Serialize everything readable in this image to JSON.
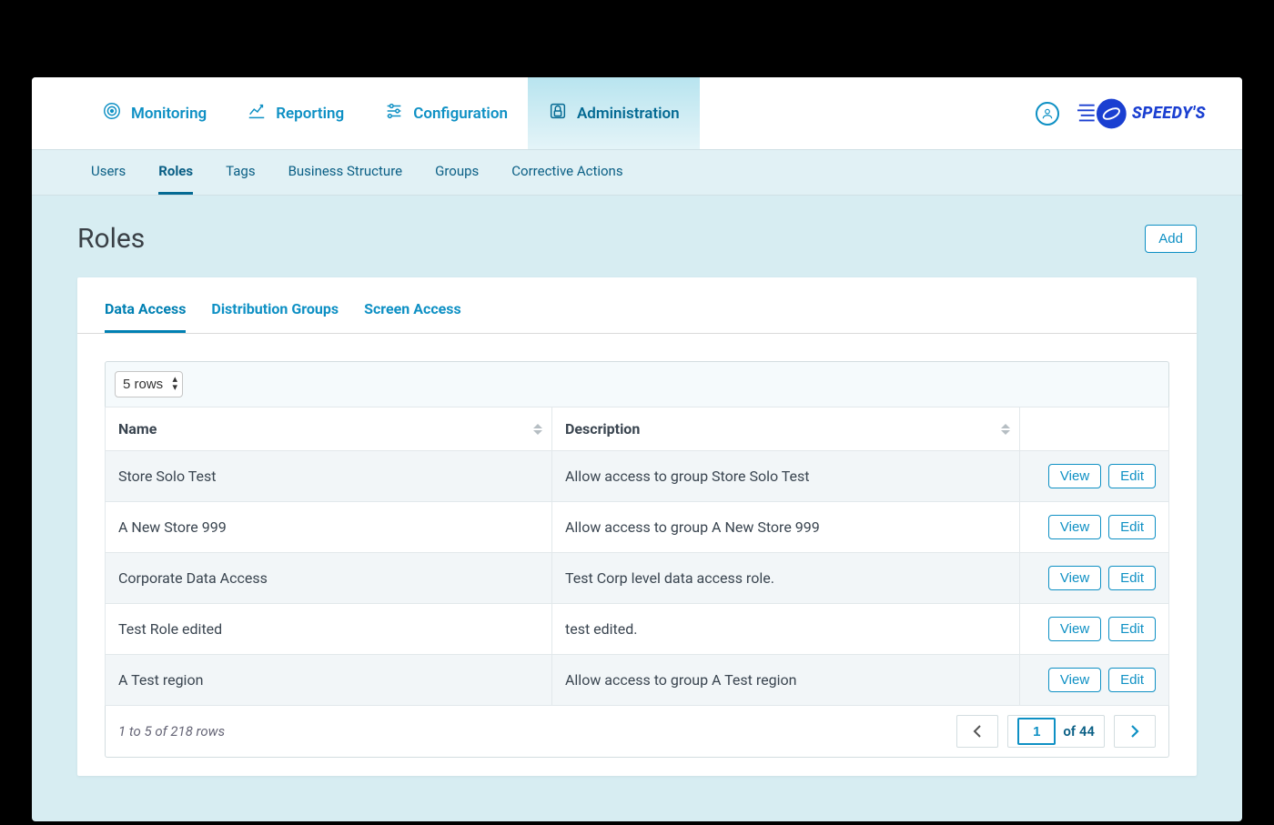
{
  "brand": {
    "name": "SPEEDY'S"
  },
  "topnav": {
    "items": [
      {
        "label": "Monitoring",
        "icon": "target-icon"
      },
      {
        "label": "Reporting",
        "icon": "chart-line-icon"
      },
      {
        "label": "Configuration",
        "icon": "sliders-icon"
      },
      {
        "label": "Administration",
        "icon": "lock-icon",
        "active": true
      }
    ]
  },
  "subnav": {
    "items": [
      {
        "label": "Users"
      },
      {
        "label": "Roles",
        "active": true
      },
      {
        "label": "Tags"
      },
      {
        "label": "Business Structure"
      },
      {
        "label": "Groups"
      },
      {
        "label": "Corrective Actions"
      }
    ]
  },
  "page": {
    "title": "Roles",
    "add_label": "Add"
  },
  "inner_tabs": {
    "items": [
      {
        "label": "Data Access",
        "active": true
      },
      {
        "label": "Distribution Groups"
      },
      {
        "label": "Screen Access"
      }
    ]
  },
  "table": {
    "rows_select_value": "5 rows",
    "columns": [
      {
        "label": "Name"
      },
      {
        "label": "Description"
      },
      {
        "label": ""
      }
    ],
    "rows": [
      {
        "name": "Store Solo Test",
        "description": "Allow access to group Store Solo Test"
      },
      {
        "name": "A New Store 999",
        "description": "Allow access to group A New Store 999"
      },
      {
        "name": "Corporate Data Access",
        "description": "Test Corp level data access role."
      },
      {
        "name": "Test Role edited",
        "description": "test edited."
      },
      {
        "name": "A Test region",
        "description": "Allow access to group A Test region"
      }
    ],
    "view_label": "View",
    "edit_label": "Edit",
    "footer_text": "1 to 5 of 218 rows",
    "page_current": "1",
    "page_of_label": "of 44"
  }
}
